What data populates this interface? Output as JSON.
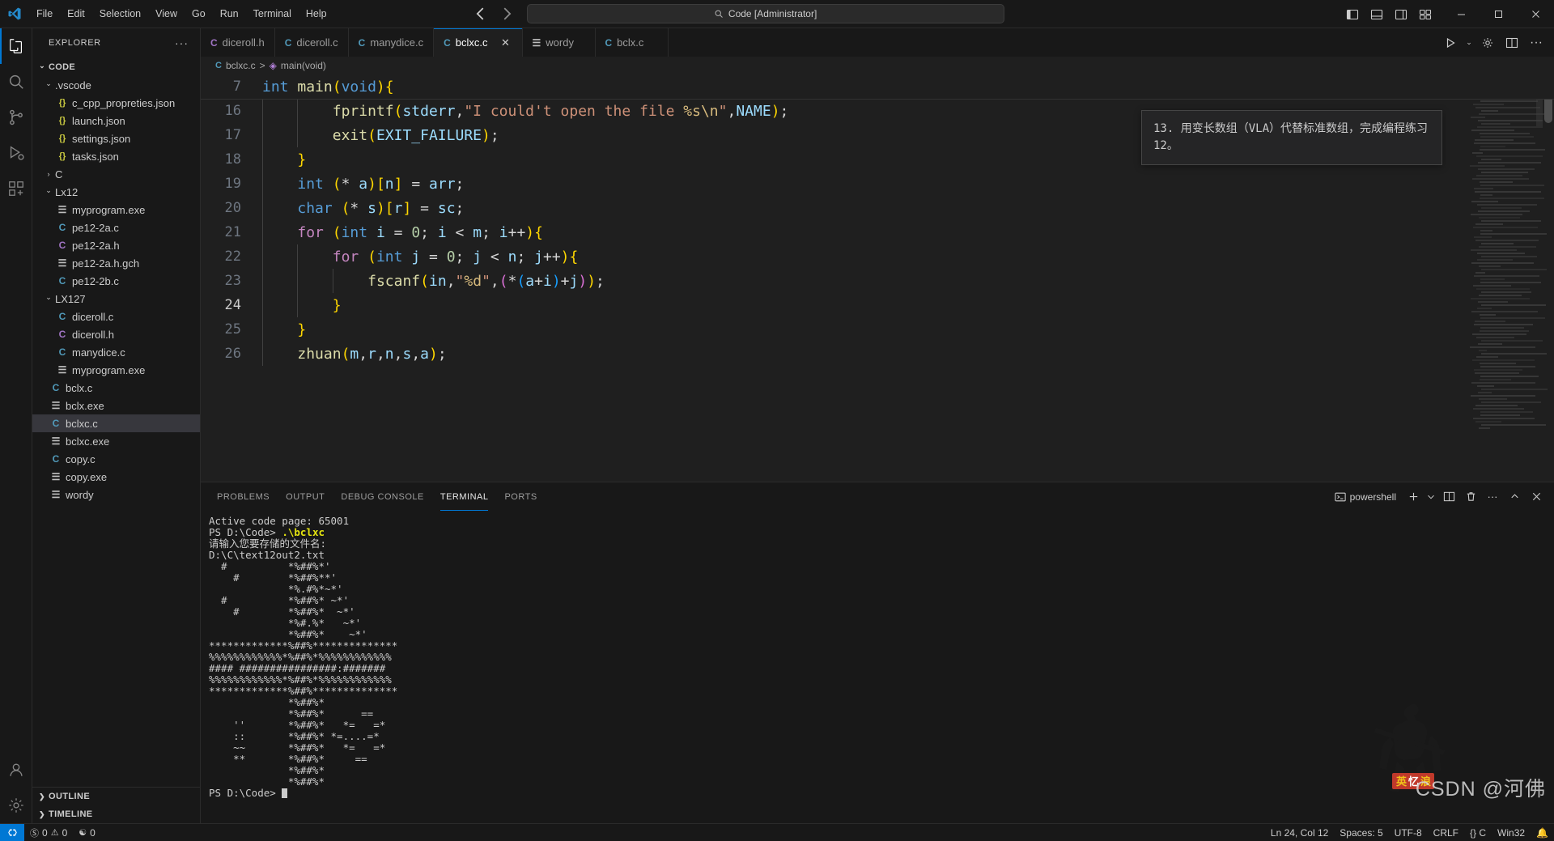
{
  "titlebar": {
    "logo_icon": "vscode-logo-icon",
    "menus": [
      "File",
      "Edit",
      "Selection",
      "View",
      "Go",
      "Run",
      "Terminal",
      "Help"
    ],
    "back_icon": "arrow-left-icon",
    "forward_icon": "arrow-right-icon",
    "command_center": {
      "icon": "search-icon",
      "text": "Code [Administrator]"
    },
    "layout_icons": [
      "toggle-primary-sidebar-icon",
      "toggle-panel-icon",
      "toggle-secondary-sidebar-icon",
      "customize-layout-icon"
    ],
    "window_buttons": [
      "minimize-button",
      "maximize-button",
      "close-button"
    ]
  },
  "activitybar": {
    "items": [
      {
        "name": "explorer",
        "icon": "files-icon",
        "active": true
      },
      {
        "name": "search",
        "icon": "search-icon",
        "active": false
      },
      {
        "name": "source-control",
        "icon": "source-control-icon",
        "active": false
      },
      {
        "name": "run-and-debug",
        "icon": "run-debug-icon",
        "active": false
      },
      {
        "name": "extensions",
        "icon": "extensions-icon",
        "active": false
      }
    ],
    "bottom": [
      {
        "name": "accounts",
        "icon": "account-icon"
      },
      {
        "name": "manage",
        "icon": "gear-icon"
      }
    ]
  },
  "explorer": {
    "title": "EXPLORER",
    "more_icon": "ellipsis-icon",
    "tree": [
      {
        "label": "CODE",
        "icon": "chevron-down-icon",
        "type": "root",
        "indent": 0,
        "expanded": true
      },
      {
        "label": ".vscode",
        "icon": "chevron-down-icon",
        "type": "folder",
        "indent": 1,
        "expanded": true
      },
      {
        "label": "c_cpp_propreties.json",
        "icon": "json-icon",
        "type": "json",
        "indent": 2
      },
      {
        "label": "launch.json",
        "icon": "json-icon",
        "type": "json",
        "indent": 2
      },
      {
        "label": "settings.json",
        "icon": "json-icon",
        "type": "json",
        "indent": 2
      },
      {
        "label": "tasks.json",
        "icon": "json-icon",
        "type": "json",
        "indent": 2
      },
      {
        "label": "C",
        "icon": "chevron-right-icon",
        "type": "folder",
        "indent": 1,
        "expanded": false
      },
      {
        "label": "Lx12",
        "icon": "chevron-down-icon",
        "type": "folder",
        "indent": 1,
        "expanded": true
      },
      {
        "label": "myprogram.exe",
        "icon": "binary-file-icon",
        "type": "file",
        "indent": 2
      },
      {
        "label": "pe12-2a.c",
        "icon": "c-file-icon",
        "type": "c",
        "indent": 2
      },
      {
        "label": "pe12-2a.h",
        "icon": "h-file-icon",
        "type": "h",
        "indent": 2
      },
      {
        "label": "pe12-2a.h.gch",
        "icon": "binary-file-icon",
        "type": "file",
        "indent": 2
      },
      {
        "label": "pe12-2b.c",
        "icon": "c-file-icon",
        "type": "c",
        "indent": 2
      },
      {
        "label": "LX127",
        "icon": "chevron-down-icon",
        "type": "folder",
        "indent": 1,
        "expanded": true
      },
      {
        "label": "diceroll.c",
        "icon": "c-file-icon",
        "type": "c",
        "indent": 2
      },
      {
        "label": "diceroll.h",
        "icon": "h-file-icon",
        "type": "h",
        "indent": 2
      },
      {
        "label": "manydice.c",
        "icon": "c-file-icon",
        "type": "c",
        "indent": 2
      },
      {
        "label": "myprogram.exe",
        "icon": "binary-file-icon",
        "type": "file",
        "indent": 2
      },
      {
        "label": "bclx.c",
        "icon": "c-file-icon",
        "type": "c",
        "indent": 1
      },
      {
        "label": "bclx.exe",
        "icon": "binary-file-icon",
        "type": "file",
        "indent": 1
      },
      {
        "label": "bclxc.c",
        "icon": "c-file-icon",
        "type": "c",
        "indent": 1,
        "selected": true
      },
      {
        "label": "bclxc.exe",
        "icon": "binary-file-icon",
        "type": "file",
        "indent": 1
      },
      {
        "label": "copy.c",
        "icon": "c-file-icon",
        "type": "c",
        "indent": 1
      },
      {
        "label": "copy.exe",
        "icon": "binary-file-icon",
        "type": "file",
        "indent": 1
      },
      {
        "label": "wordy",
        "icon": "binary-file-icon",
        "type": "file",
        "indent": 1
      }
    ],
    "sections": [
      {
        "label": "OUTLINE",
        "icon": "chevron-right-icon"
      },
      {
        "label": "TIMELINE",
        "icon": "chevron-right-icon"
      }
    ]
  },
  "tabs": {
    "items": [
      {
        "label": "diceroll.h",
        "type": "h",
        "active": false
      },
      {
        "label": "diceroll.c",
        "type": "c",
        "active": false
      },
      {
        "label": "manydice.c",
        "type": "c",
        "active": false
      },
      {
        "label": "bclxc.c",
        "type": "c",
        "active": true,
        "close_icon": "close-icon"
      },
      {
        "label": "wordy",
        "type": "file",
        "active": false
      },
      {
        "label": "bclx.c",
        "type": "c",
        "active": false
      }
    ],
    "actions": [
      "run-icon",
      "split-editor-chevron-icon",
      "settings-gear-icon",
      "split-editor-right-icon",
      "open-changes-icon",
      "more-actions-icon"
    ]
  },
  "breadcrumb": {
    "file": "bclxc.c",
    "separator": ">",
    "symbol": "main(void)",
    "file_icon": "c-file-icon",
    "symbol_icon": "method-symbol-icon"
  },
  "notification": {
    "text": "13. 用变长数组（VLA）代替标准数组，完成编程练习12。"
  },
  "editor": {
    "sticky": {
      "num": "7",
      "text": "int main(void){"
    },
    "lines": [
      {
        "num": "16",
        "text": "        fprintf(stderr,\"I could't open the file %s\\n\",NAME);"
      },
      {
        "num": "17",
        "text": "        exit(EXIT_FAILURE);"
      },
      {
        "num": "18",
        "text": "    }"
      },
      {
        "num": "19",
        "text": "    int (* a)[n] = arr;"
      },
      {
        "num": "20",
        "text": "    char (* s)[r] = sc;"
      },
      {
        "num": "21",
        "text": "    for (int i = 0; i < m; i++){"
      },
      {
        "num": "22",
        "text": "        for (int j = 0; j < n; j++){"
      },
      {
        "num": "23",
        "text": "            fscanf(in,\"%d\",(*(a+i)+j));"
      },
      {
        "num": "24",
        "text": "        }",
        "current": true
      },
      {
        "num": "25",
        "text": "    }"
      },
      {
        "num": "26",
        "text": "    zhuan(m,r,n,s,a);"
      }
    ]
  },
  "panel": {
    "tabs": [
      {
        "label": "PROBLEMS",
        "active": false
      },
      {
        "label": "OUTPUT",
        "active": false
      },
      {
        "label": "DEBUG CONSOLE",
        "active": false
      },
      {
        "label": "TERMINAL",
        "active": true
      },
      {
        "label": "PORTS",
        "active": false
      }
    ],
    "shell": {
      "label": "powershell",
      "icon": "terminal-powershell-icon"
    },
    "actions": [
      "new-terminal-icon",
      "terminal-dropdown-chevron-icon",
      "split-terminal-icon",
      "kill-terminal-icon",
      "more-actions-icon",
      "maximize-panel-icon",
      "close-panel-icon"
    ],
    "terminal_lines": [
      {
        "text": "Active code page: 65001",
        "class": "g"
      },
      {
        "text": "PS D:\\Code> ",
        "class": "g",
        "cmd": ".\\bclxc"
      },
      {
        "text": "请输入您要存储的文件名:",
        "class": "g"
      },
      {
        "text": "D:\\C\\text12out2.txt",
        "class": "g"
      },
      {
        "text": "  #          *%##%*'",
        "class": "g"
      },
      {
        "text": "    #        *%##%**'",
        "class": "g"
      },
      {
        "text": "             *%.#%*~*'",
        "class": "g"
      },
      {
        "text": "  #          *%##%* ~*'",
        "class": "g"
      },
      {
        "text": "    #        *%##%*  ~*'",
        "class": "g"
      },
      {
        "text": "             *%#.%*   ~*'",
        "class": "g"
      },
      {
        "text": "             *%##%*    ~*'",
        "class": "g"
      },
      {
        "text": "*************%##%**************",
        "class": "g"
      },
      {
        "text": "%%%%%%%%%%%%*%##%*%%%%%%%%%%%%",
        "class": "g"
      },
      {
        "text": "#### ################:#######",
        "class": "g"
      },
      {
        "text": "%%%%%%%%%%%%*%##%*%%%%%%%%%%%%",
        "class": "g"
      },
      {
        "text": "*************%##%**************",
        "class": "g"
      },
      {
        "text": "             *%##%*",
        "class": "g"
      },
      {
        "text": "             *%##%*      ==",
        "class": "g"
      },
      {
        "text": "    ''       *%##%*   *=   =*",
        "class": "g"
      },
      {
        "text": "    ::       *%##%* *=....=*",
        "class": "g"
      },
      {
        "text": "    ~~       *%##%*   *=   =*",
        "class": "g"
      },
      {
        "text": "    **       *%##%*     ==",
        "class": "g"
      },
      {
        "text": "             *%##%*",
        "class": "g"
      },
      {
        "text": "             *%##%*",
        "class": "g"
      },
      {
        "text": "",
        "class": "g"
      },
      {
        "text": "PS D:\\Code> ",
        "class": "g",
        "cursor": true
      }
    ],
    "watermark": "CSDN @河佛"
  },
  "statusbar": {
    "remote_icon": "remote-window-icon",
    "left": [
      {
        "icon": "error-icon",
        "label": "0"
      },
      {
        "icon": "warning-icon",
        "label": "0"
      },
      {
        "icon": "radio-tower-icon",
        "label": "0"
      }
    ],
    "right": [
      {
        "label": "Ln 24, Col 12"
      },
      {
        "label": "Spaces: 5"
      },
      {
        "label": "UTF-8"
      },
      {
        "label": "CRLF"
      },
      {
        "label": "{}  C"
      },
      {
        "label": "Win32"
      },
      {
        "icon": "bell-icon",
        "label": ""
      }
    ]
  }
}
